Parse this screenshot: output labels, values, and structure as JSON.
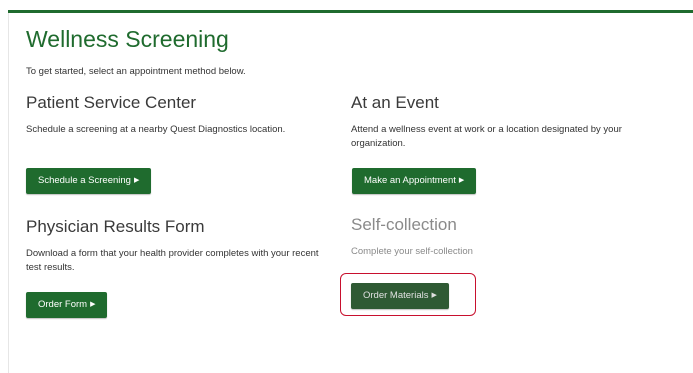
{
  "page": {
    "title": "Wellness Screening",
    "intro": "To get started, select an appointment method below."
  },
  "cards": {
    "patient_service_center": {
      "title": "Patient Service Center",
      "description": "Schedule a screening at a nearby Quest Diagnostics location.",
      "button_label": "Schedule a Screening"
    },
    "at_an_event": {
      "title": "At an Event",
      "description": "Attend a wellness event at work or a location designated by your organization.",
      "button_label": "Make an Appointment"
    },
    "physician_results_form": {
      "title": "Physician Results Form",
      "description": "Download a form that your health provider completes with your recent test results.",
      "button_label": "Order Form"
    },
    "self_collection": {
      "title": "Self-collection",
      "description": "Complete your self-collection",
      "button_label": "Order Materials"
    }
  },
  "icons": {
    "button_arrow": "triangle-right-icon",
    "arrow_glyph": "▶"
  },
  "colors": {
    "brand_green": "#1f6b2e",
    "highlight_red": "#c8102e"
  }
}
